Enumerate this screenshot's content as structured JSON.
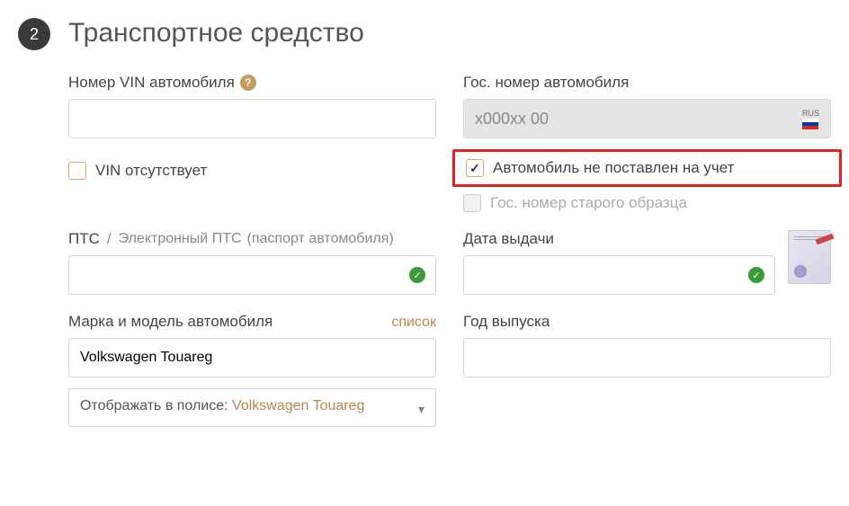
{
  "section": {
    "step_number": "2",
    "title": "Транспортное средство"
  },
  "vin": {
    "label": "Номер VIN автомобиля",
    "value": "",
    "absent_label": "VIN отсутствует",
    "absent_checked": false
  },
  "plate": {
    "label": "Гос. номер автомобиля",
    "placeholder": "х000хх 00",
    "region_code": "RUS",
    "not_registered_label": "Автомобиль не поставлен на учет",
    "not_registered_checked": true,
    "old_format_label": "Гос. номер старого образца",
    "old_format_checked": false
  },
  "pts": {
    "label_main": "ПТС",
    "label_alt": "Электронный ПТС",
    "label_note": "(паспорт автомобиля)",
    "value": ""
  },
  "issue_date": {
    "label": "Дата выдачи",
    "value": ""
  },
  "make_model": {
    "label": "Марка и модель автомобиля",
    "list_link": "список",
    "value": "Volkswagen Touareg"
  },
  "year": {
    "label": "Год выпуска",
    "value": ""
  },
  "polis": {
    "prefix": "Отображать в полисе: ",
    "brand": "Volkswagen Touareg"
  }
}
